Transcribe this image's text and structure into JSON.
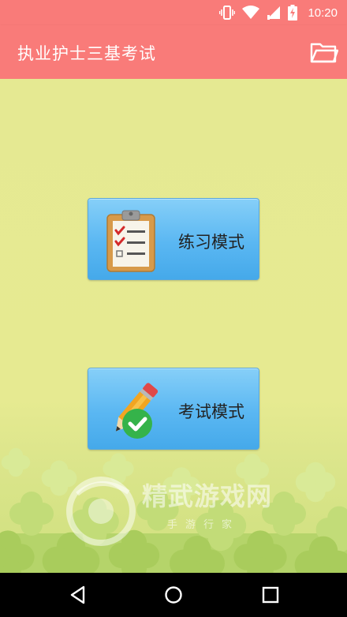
{
  "status_bar": {
    "time": "10:20",
    "icons": [
      "vibrate-icon",
      "wifi-icon",
      "signal-icon",
      "battery-charging-icon"
    ]
  },
  "app_bar": {
    "title": "执业护士三基考试",
    "background_color": "#f97b79",
    "action_icon": "folder-icon"
  },
  "main": {
    "background_color": "#e5e992",
    "buttons": [
      {
        "label": "练习模式",
        "icon": "clipboard-checklist-icon"
      },
      {
        "label": "考试模式",
        "icon": "pencil-check-icon"
      }
    ]
  },
  "watermark": {
    "title": "精武游戏网",
    "subtitle": "手游行家"
  },
  "nav_bar": {
    "icons": [
      "back-icon",
      "home-icon",
      "recents-icon"
    ]
  }
}
